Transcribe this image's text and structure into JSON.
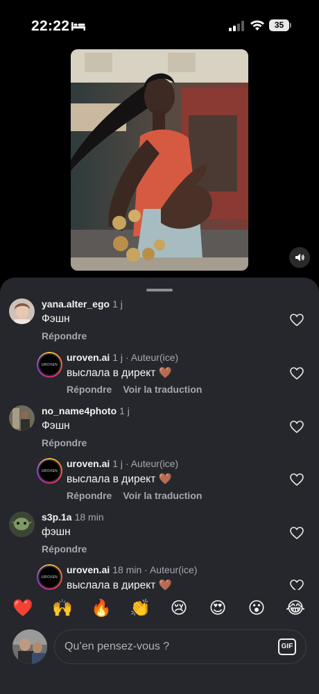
{
  "status_bar": {
    "time": "22:22",
    "battery": "35",
    "icons": [
      "bed-icon",
      "signal-icon",
      "wifi-icon",
      "battery-icon"
    ]
  },
  "video": {
    "sound_icon": "speaker-icon"
  },
  "comments": [
    {
      "username": "yana.alter_ego",
      "time": "1 j",
      "author_label": "",
      "text": "Фэшн",
      "actions": [
        "Répondre"
      ]
    },
    {
      "username": "uroven.ai",
      "time": "1 j",
      "author_label": "· Auteur(ice)",
      "text": "выслала в директ 🤎",
      "actions": [
        "Répondre",
        "Voir la traduction"
      ]
    },
    {
      "username": "no_name4photo",
      "time": "1 j",
      "author_label": "",
      "text": "Фэшн",
      "actions": [
        "Répondre"
      ]
    },
    {
      "username": "uroven.ai",
      "time": "1 j",
      "author_label": "· Auteur(ice)",
      "text": "выслала в директ 🤎",
      "actions": [
        "Répondre",
        "Voir la traduction"
      ]
    },
    {
      "username": "s3p.1a",
      "time": "18 min",
      "author_label": "",
      "text": "фэшн",
      "actions": [
        "Répondre"
      ]
    },
    {
      "username": "uroven.ai",
      "time": "18 min",
      "author_label": "· Auteur(ice)",
      "text": "выслала в директ 🤎",
      "actions": []
    }
  ],
  "avatar_logo_text": "UROVEN",
  "emoji_bar": [
    "❤️",
    "🙌",
    "🔥",
    "👏",
    "😢",
    "😍",
    "😮",
    "😂"
  ],
  "composer": {
    "placeholder": "Qu’en pensez-vous ?",
    "gif_label": "GIF"
  },
  "colors": {
    "sheet_bg": "#25272c",
    "muted_text": "#a6a8ad",
    "accent_ring": "#d92b7f"
  }
}
